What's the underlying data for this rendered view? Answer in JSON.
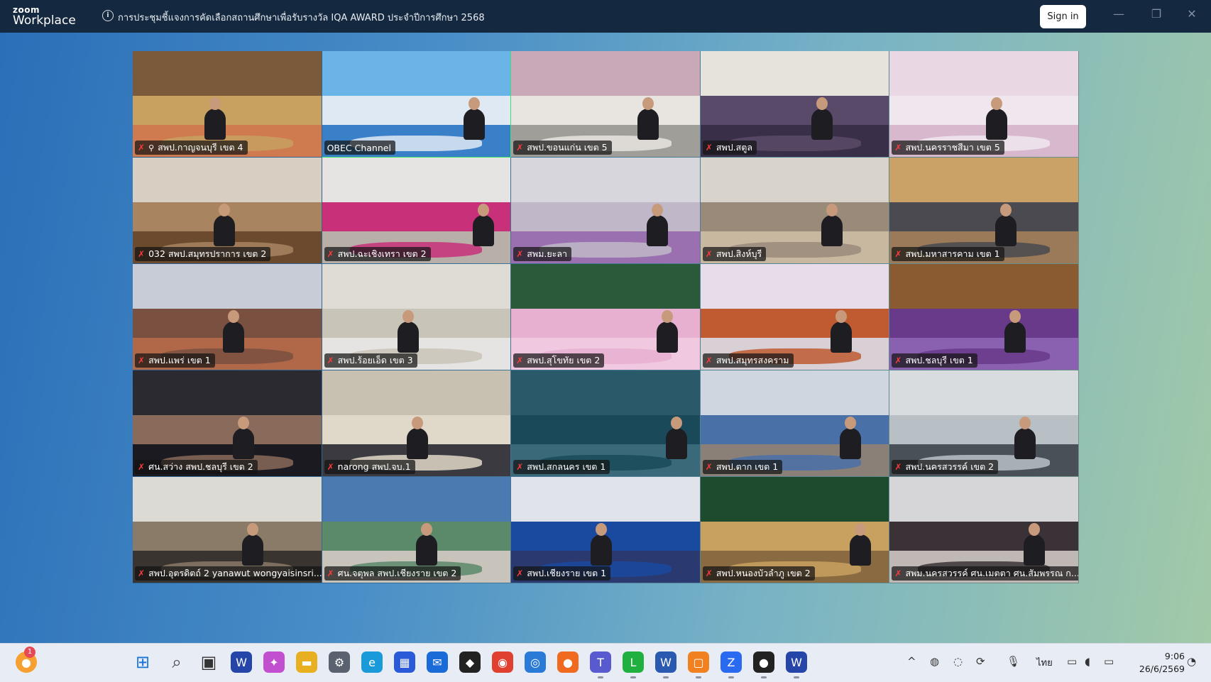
{
  "app": {
    "logo_line1": "zoom",
    "logo_line2": "Workplace"
  },
  "meeting": {
    "title": "การประชุมชี้แจงการคัดเลือกสถานศึกษาเพื่อรับรางวัล IQA AWARD ประจำปีการศึกษา 2568",
    "signin_label": "Sign in"
  },
  "window_controls": {
    "minimize": "—",
    "restore": "❐",
    "close": "✕"
  },
  "participants": [
    {
      "name": "สพป.กาญจนบุรี เขต 4",
      "muted": true,
      "pinned": true,
      "colors": [
        "#7a5a3a",
        "#c8a060",
        "#d07a50"
      ]
    },
    {
      "name": "OBEC Channel",
      "muted": false,
      "pinned": false,
      "active": true,
      "colors": [
        "#6ab4e8",
        "#dfe9f3",
        "#3a80c8"
      ]
    },
    {
      "name": "สพป.ขอนแก่น เขต 5",
      "muted": true,
      "pinned": false,
      "colors": [
        "#c9a8b8",
        "#e8e4e0",
        "#a09e98"
      ]
    },
    {
      "name": "สพป.สตูล",
      "muted": true,
      "pinned": false,
      "colors": [
        "#e6e2dc",
        "#5a4a6a",
        "#3a2f48"
      ]
    },
    {
      "name": "สพป.นครราชสีมา เขต 5",
      "muted": true,
      "pinned": false,
      "colors": [
        "#e9d8e4",
        "#f0e6ee",
        "#d8b8cc"
      ]
    },
    {
      "name": "032 สพป.สมุทรปราการ เขต 2",
      "muted": true,
      "pinned": false,
      "colors": [
        "#d8cfc2",
        "#a88460",
        "#6b4a2e"
      ]
    },
    {
      "name": "สพป.ฉะเชิงเทรา เขต 2",
      "muted": true,
      "pinned": false,
      "colors": [
        "#e6e4e2",
        "#c8307a",
        "#b8b0a8"
      ]
    },
    {
      "name": "สพม.ยะลา",
      "muted": true,
      "pinned": false,
      "colors": [
        "#d6d6dc",
        "#c0b8c8",
        "#9a70b0"
      ]
    },
    {
      "name": "สพป.สิงห์บุรี",
      "muted": true,
      "pinned": false,
      "colors": [
        "#d8d4cc",
        "#9a8a7a",
        "#c8b8a0"
      ]
    },
    {
      "name": "สพป.มหาสารคาม เขต 1",
      "muted": true,
      "pinned": false,
      "colors": [
        "#caa268",
        "#4a4a50",
        "#9a7a58"
      ]
    },
    {
      "name": "สพป.แพร่ เขต 1",
      "muted": true,
      "pinned": false,
      "colors": [
        "#c8ccd6",
        "#7a5040",
        "#b06848"
      ]
    },
    {
      "name": "สพป.ร้อยเอ็ด เขต 3",
      "muted": true,
      "pinned": false,
      "colors": [
        "#dedcd4",
        "#c8c4b8",
        "#e6e4e2"
      ]
    },
    {
      "name": "สพป.สุโขทัย เขต 2",
      "muted": true,
      "pinned": false,
      "colors": [
        "#2a5a3a",
        "#e8b0d0",
        "#f0c8e0"
      ]
    },
    {
      "name": "สพป.สมุทรสงคราม",
      "muted": true,
      "pinned": false,
      "colors": [
        "#e6dcea",
        "#c05a30",
        "#d8d0d4"
      ]
    },
    {
      "name": "สพป.ชลบุรี เขต 1",
      "muted": true,
      "pinned": false,
      "colors": [
        "#8a5a30",
        "#6a3a8a",
        "#8a60b0"
      ]
    },
    {
      "name": "ศน.สว่าง สพป.ชลบุรี เขต 2",
      "muted": true,
      "pinned": false,
      "colors": [
        "#2a2a30",
        "#8a6a5a",
        "#1a1a20"
      ]
    },
    {
      "name": "narong สพป.จบ.1",
      "muted": true,
      "pinned": false,
      "colors": [
        "#c8c0b0",
        "#e0d8c8",
        "#3a3a40"
      ]
    },
    {
      "name": "สพป.สกลนคร เขต 1",
      "muted": true,
      "pinned": false,
      "colors": [
        "#2a5a6a",
        "#1a4a5a",
        "#3a6a7a"
      ]
    },
    {
      "name": "สพป.ตาก เขต 1",
      "muted": true,
      "pinned": false,
      "colors": [
        "#d0d6e0",
        "#4a70a8",
        "#8a8078"
      ]
    },
    {
      "name": "สพป.นครสวรรค์ เขต 2",
      "muted": true,
      "pinned": false,
      "colors": [
        "#d8dcde",
        "#b8c0c6",
        "#4a5058"
      ]
    },
    {
      "name": "สพป.อุตรดิตถ์ 2 yanawut wongyaisinsri...",
      "muted": true,
      "pinned": false,
      "colors": [
        "#dcdad4",
        "#8a7a68",
        "#3a3430"
      ]
    },
    {
      "name": "ศน.จตุพล สพป.เชียงราย เขต 2",
      "muted": true,
      "pinned": false,
      "colors": [
        "#4a7ab0",
        "#5a8a6a",
        "#c8c4bc"
      ]
    },
    {
      "name": "สพป.เชียงราย เขต 1",
      "muted": true,
      "pinned": false,
      "colors": [
        "#e0e4ea",
        "#1a4aa0",
        "#2a3a70"
      ]
    },
    {
      "name": "สพป.หนองบัวลำภู เขต 2",
      "muted": true,
      "pinned": false,
      "colors": [
        "#1e4a2e",
        "#c8a060",
        "#8a6a40"
      ]
    },
    {
      "name": "สพม.นครสวรรค์ ศน.เมตตา ศน.สัมพรรณ ก...",
      "muted": true,
      "pinned": false,
      "colors": [
        "#d6d6d8",
        "#3a3236",
        "#c0b8b4"
      ]
    }
  ],
  "taskbar": {
    "notification_count": "1",
    "icons": [
      {
        "name": "start-icon",
        "glyph": "⊞",
        "color": "#1a73d8"
      },
      {
        "name": "search-icon",
        "glyph": "⌕",
        "color": "#444"
      },
      {
        "name": "task-view-icon",
        "glyph": "▣",
        "color": "#333"
      },
      {
        "name": "app-w-icon",
        "glyph": "W",
        "color": "#2546a8"
      },
      {
        "name": "copilot-icon",
        "glyph": "✦",
        "color": "#c24fd0"
      },
      {
        "name": "file-explorer-icon",
        "glyph": "▬",
        "color": "#e8b020"
      },
      {
        "name": "settings-icon",
        "glyph": "⚙",
        "color": "#5a6270"
      },
      {
        "name": "edge-icon",
        "glyph": "e",
        "color": "#1a9ad8"
      },
      {
        "name": "store-icon",
        "glyph": "▦",
        "color": "#2a5ad8"
      },
      {
        "name": "outlook-icon",
        "glyph": "✉",
        "color": "#1a6ad8"
      },
      {
        "name": "dropbox-icon",
        "glyph": "◆",
        "color": "#222"
      },
      {
        "name": "chrome-icon",
        "glyph": "◉",
        "color": "#e04030"
      },
      {
        "name": "camera-icon",
        "glyph": "◎",
        "color": "#2a7ad8"
      },
      {
        "name": "firefox-icon",
        "glyph": "●",
        "color": "#f06a20"
      },
      {
        "name": "teams-icon",
        "glyph": "T",
        "color": "#5a5ad0"
      },
      {
        "name": "line-icon",
        "glyph": "L",
        "color": "#20b040"
      },
      {
        "name": "word-icon",
        "glyph": "W",
        "color": "#2a5ab0"
      },
      {
        "name": "photos-icon",
        "glyph": "▢",
        "color": "#f08020"
      },
      {
        "name": "zoom-icon",
        "glyph": "Z",
        "color": "#2a6af0"
      },
      {
        "name": "media-icon",
        "glyph": "●",
        "color": "#222"
      },
      {
        "name": "app-w2-icon",
        "glyph": "W",
        "color": "#2546a8"
      }
    ],
    "tray": [
      {
        "name": "chevron-up-icon",
        "glyph": "^"
      },
      {
        "name": "shield-icon",
        "glyph": "◍"
      },
      {
        "name": "bell-icon",
        "glyph": "◌"
      },
      {
        "name": "sync-icon",
        "glyph": "⟳"
      },
      {
        "name": "microphone-icon",
        "glyph": "🎙"
      }
    ],
    "language": "ไทย",
    "time": "9:06",
    "date": "26/6/2569"
  }
}
